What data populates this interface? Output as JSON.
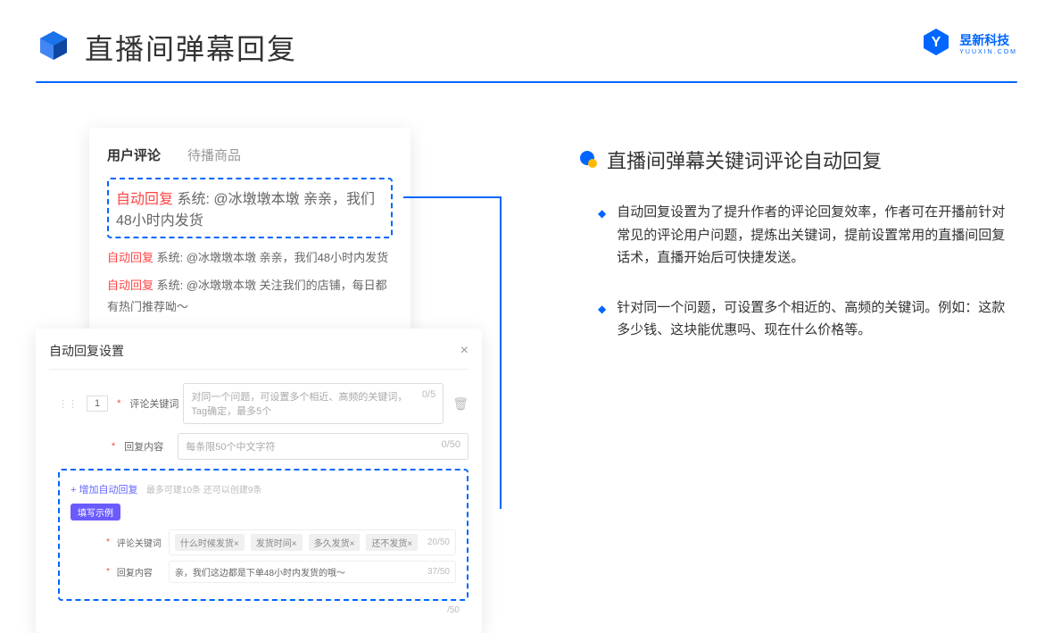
{
  "header": {
    "title": "直播间弹幕回复"
  },
  "brand": {
    "name_cn": "昱新科技",
    "name_en": "YUUXIN.COM"
  },
  "comments_card": {
    "tabs": [
      {
        "label": "用户评论",
        "active": true
      },
      {
        "label": "待播商品",
        "active": false
      }
    ],
    "highlighted": {
      "tag": "自动回复",
      "text": "系统: @冰墩墩本墩 亲亲，我们48小时内发货"
    },
    "items": [
      {
        "tag": "自动回复",
        "text": "系统: @冰墩墩本墩 亲亲，我们48小时内发货"
      },
      {
        "tag": "自动回复",
        "text": "系统: @冰墩墩本墩 关注我们的店铺，每日都有热门推荐呦～"
      }
    ]
  },
  "settings_card": {
    "title": "自动回复设置",
    "row_num": "1",
    "keyword_label": "评论关键词",
    "keyword_placeholder": "对同一个问题，可设置多个相近、高频的关键词，Tag确定，最多5个",
    "keyword_counter": "0/5",
    "content_label": "回复内容",
    "content_placeholder": "每条限50个中文字符",
    "content_counter": "0/50",
    "add_link": "+ 增加自动回复",
    "add_hint": "最多可建10条 还可以创建9条",
    "example_badge": "填写示例",
    "example_keyword_label": "评论关键词",
    "example_tags": [
      "什么时候发货×",
      "发货时间×",
      "多久发货×",
      "还不发货×"
    ],
    "example_keyword_counter": "20/50",
    "example_content_label": "回复内容",
    "example_content_text": "亲，我们这边都是下单48小时内发货的哦～",
    "example_content_counter": "37/50",
    "bottom_counter": "/50"
  },
  "right": {
    "section_title": "直播间弹幕关键词评论自动回复",
    "bullets": [
      "自动回复设置为了提升作者的评论回复效率，作者可在开播前针对常见的评论用户问题，提炼出关键词，提前设置常用的直播间回复话术，直播开始后可快捷发送。",
      "针对同一个问题，可设置多个相近的、高频的关键词。例如：这款多少钱、这块能优惠吗、现在什么价格等。"
    ]
  }
}
